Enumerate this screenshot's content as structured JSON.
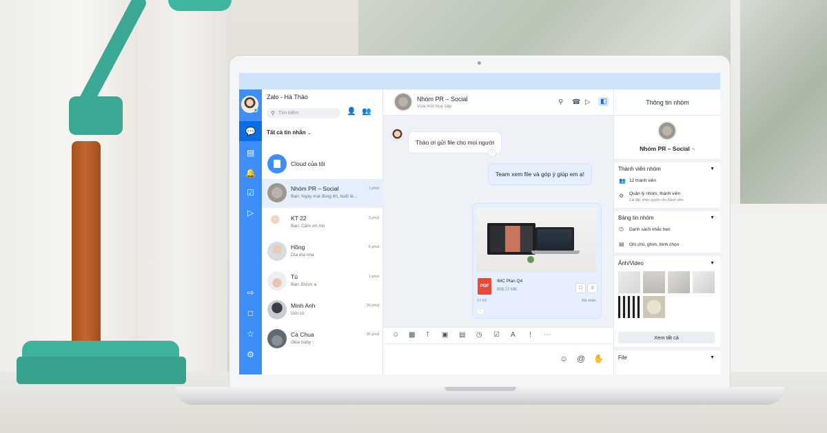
{
  "app": {
    "title": "Zalo - Hà Thảo",
    "search_placeholder": "Tìm kiếm",
    "filter_label": "Tất cả tin nhắn"
  },
  "nav": {
    "icons": [
      "chat-icon",
      "contacts-icon",
      "bell-icon",
      "todo-icon",
      "video-icon",
      "transfer-icon",
      "screenshot-icon",
      "star-icon",
      "settings-icon"
    ]
  },
  "conversations": [
    {
      "name": "Cloud của tôi",
      "preview": "",
      "time": ""
    },
    {
      "name": "Nhóm PR – Social",
      "preview": "Bạn: Ngày mai đúng 8h, buổi lễ...",
      "time": "1 phút"
    },
    {
      "name": "KT 22",
      "preview": "Bạn: Cảm ơn mn",
      "time": "3 phút"
    },
    {
      "name": "Hồng",
      "preview": "Dìa dìa nha",
      "time": "5 phút"
    },
    {
      "name": "Tú",
      "preview": "Bạn: Được ạ",
      "time": "1 phút"
    },
    {
      "name": "Minh Anh",
      "preview": "Gửi cô",
      "time": "30 phút"
    },
    {
      "name": "Cà Chua",
      "preview": "Okie baby",
      "time": "35 phút"
    }
  ],
  "chat": {
    "group_name": "Nhóm PR – Social",
    "status": "Vừa mới truy cập",
    "messages": [
      {
        "text": "Thảo ơi gửi file cho mọi người"
      },
      {
        "text": "Team xem file và góp ý giúp em ạ!"
      }
    ],
    "file": {
      "name": "IMC Plan Q4",
      "size": "858,72 MB",
      "time": "17:53",
      "status": "Đã nhận",
      "type_label": "PDF"
    }
  },
  "info": {
    "title": "Thông tin nhóm",
    "group_name": "Nhóm PR – Social",
    "members_section": "Thành viên nhóm",
    "member_count": "12 thành viên",
    "manage_title": "Quản lý nhóm, thành viên",
    "manage_sub": "Cài đặt, phân quyền cho thành viên",
    "board_section": "Bảng tin nhóm",
    "reminders": "Danh sách nhắc hẹn",
    "notes": "Ghi chú, ghim, bình chọn",
    "media_section": "Ảnh/Video",
    "see_all": "Xem tất cả",
    "file_section": "File"
  },
  "colors": {
    "brand_blue": "#3d8ef7",
    "active_blue": "#0b6de3",
    "titlebar": "#cfe3fb",
    "my_bubble": "#e5efff"
  }
}
